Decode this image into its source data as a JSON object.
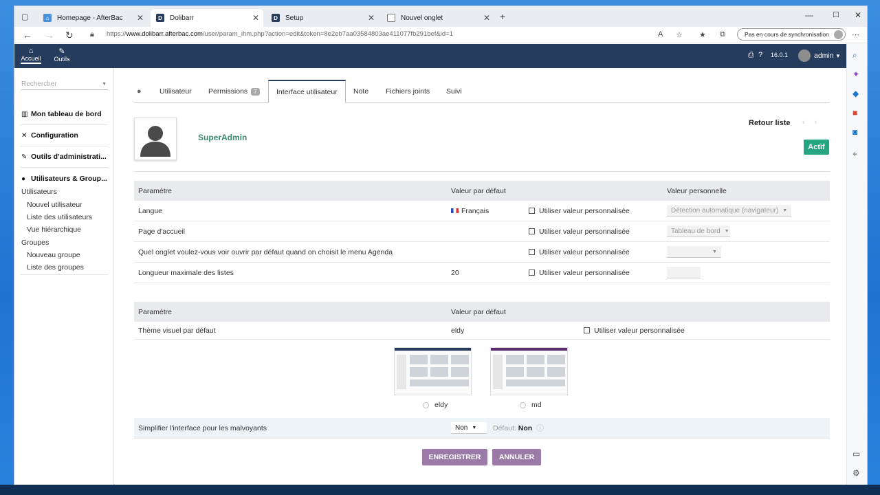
{
  "browser": {
    "tabs": [
      {
        "title": "Homepage - AfterBac",
        "favicon": "afterbac-icon"
      },
      {
        "title": "Dolibarr",
        "favicon": "dolibarr-icon"
      },
      {
        "title": "Setup",
        "favicon": "dolibarr-icon"
      },
      {
        "title": "Nouvel onglet",
        "favicon": "page-icon"
      }
    ],
    "url_prefix": "https://",
    "url_domain": "www.dolibarr.afterbac.com",
    "url_path": "/user/param_ihm.php?action=edit&token=8e2eb7aa03584803ae411077fb291bef&id=1",
    "sync_label": "Pas en cours de synchronisation"
  },
  "topbar": {
    "menu": [
      {
        "label": "Accueil",
        "icon": "home-icon"
      },
      {
        "label": "Outils",
        "icon": "wrench-icon"
      }
    ],
    "version": "16.0.1",
    "user": "admin"
  },
  "leftmenu": {
    "search_placeholder": "Rechercher",
    "sections": [
      {
        "label": "Mon tableau de bord",
        "icon": "chart-icon"
      },
      {
        "label": "Configuration",
        "icon": "tools-icon"
      },
      {
        "label": "Outils d'administrati...",
        "icon": "admin-icon"
      },
      {
        "label": "Utilisateurs & Group...",
        "icon": "user-icon"
      }
    ],
    "items": [
      "Utilisateurs",
      "Nouvel utilisateur",
      "Liste des utilisateurs",
      "Vue hiérarchique",
      "Groupes",
      "Nouveau groupe",
      "Liste des groupes"
    ]
  },
  "tabs": {
    "items": [
      {
        "label": "Utilisateur"
      },
      {
        "label": "Permissions",
        "badge": "7"
      },
      {
        "label": "Interface utilisateur"
      },
      {
        "label": "Note"
      },
      {
        "label": "Fichiers joints"
      },
      {
        "label": "Suivi"
      }
    ]
  },
  "user_card": {
    "name": "SuperAdmin",
    "back_label": "Retour liste",
    "status": "Actif"
  },
  "table1": {
    "headers": [
      "Paramètre",
      "Valeur par défaut",
      "Valeur personnelle"
    ],
    "custom_label": "Utiliser valeur personnalisée",
    "rows": [
      {
        "param": "Langue",
        "default": "Français",
        "personal": "Détection automatique (navigateur)"
      },
      {
        "param": "Page d'accueil",
        "default": "",
        "personal": "Tableau de bord"
      },
      {
        "param": "Quel onglet voulez-vous voir ouvrir par défaut quand on choisit le menu Agenda",
        "default": "",
        "personal": ""
      },
      {
        "param": "Longueur maximale des listes",
        "default": "20",
        "personal": ""
      }
    ]
  },
  "table2": {
    "headers": [
      "Paramètre",
      "Valeur par défaut"
    ],
    "theme_row": {
      "param": "Thème visuel par défaut",
      "default": "eldy",
      "custom_label": "Utiliser valeur personnalisée"
    },
    "themes": [
      "eldy",
      "md"
    ],
    "accessibility": {
      "param": "Simplifier l'interface pour les malvoyants",
      "value": "Non",
      "default_label": "Défaut:",
      "default_value": "Non"
    }
  },
  "actions": {
    "save": "ENREGISTRER",
    "cancel": "ANNULER"
  },
  "colors": {
    "topbar": "#263c5c",
    "username": "#3a8a72",
    "status": "#25a580",
    "button": "#9c7aa8"
  }
}
